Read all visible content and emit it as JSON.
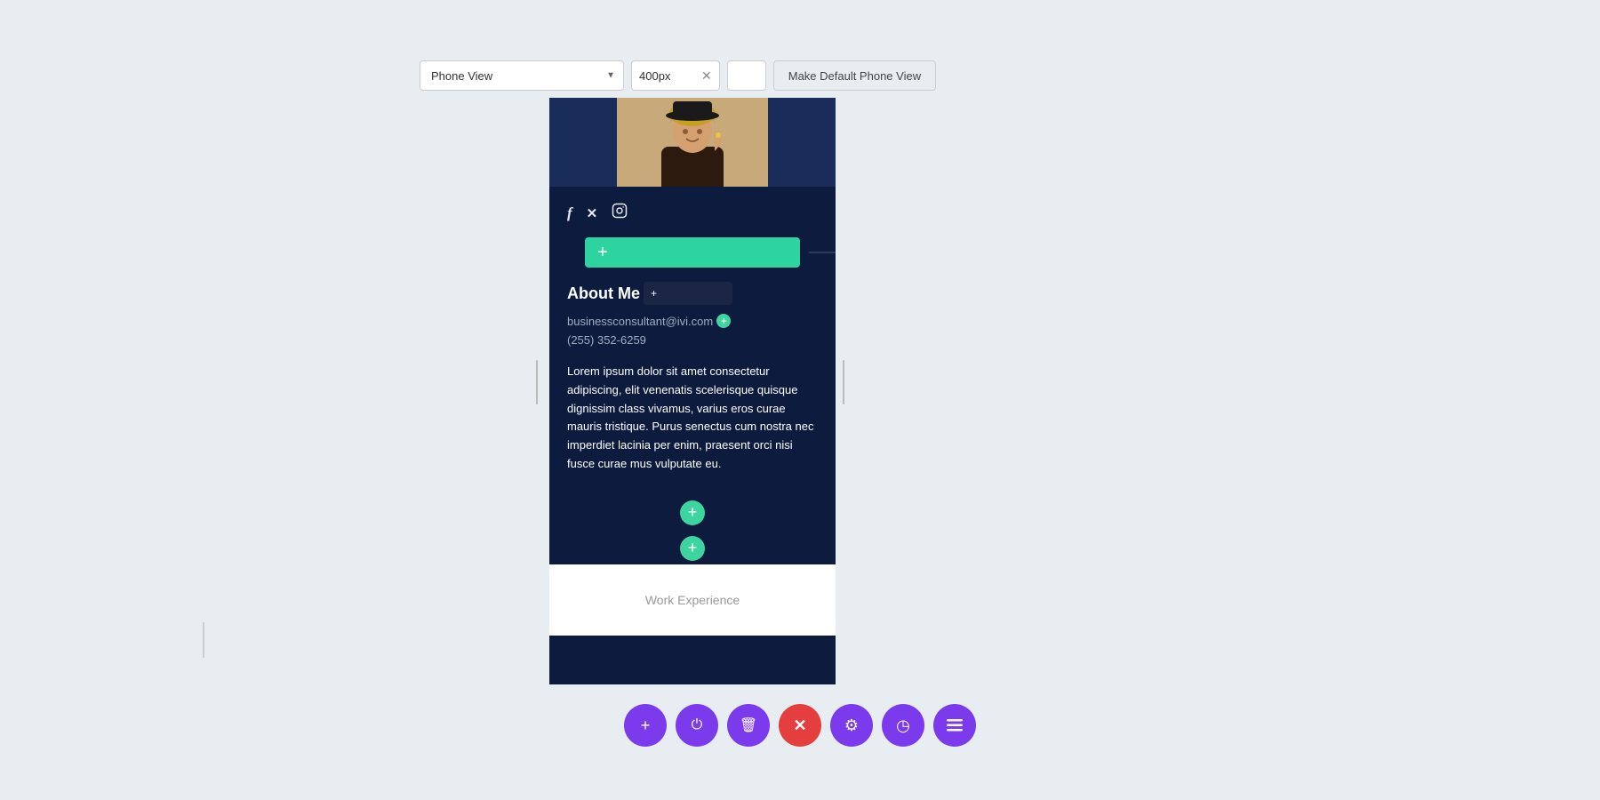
{
  "toolbar": {
    "view_label": "Phone View",
    "px_value": "400px",
    "make_default_label": "Make Default Phone View"
  },
  "preview": {
    "social_icons": [
      "f",
      "𝕏",
      "◻"
    ],
    "add_block_label": "+",
    "about_title": "About Me",
    "contact_email": "businessconsultant@ivi.com",
    "contact_phone": "(255) 352-6259",
    "lorem_text": "Lorem ipsum dolor sit amet consectetur adipiscing, elit venenatis scelerisque quisque dignissim class vivamus, varius eros curae mauris tristique. Purus senectus cum nostra nec imperdiet lacinia per enim, praesent orci nisi fusce curae mus vulputate eu.",
    "work_exp_label": "Work Experience"
  },
  "bottom_toolbar": {
    "add_icon": "+",
    "power_icon": "⏻",
    "trash_icon": "🗑",
    "close_icon": "✕",
    "settings_icon": "⚙",
    "clock_icon": "◷",
    "bars_icon": "≡"
  }
}
